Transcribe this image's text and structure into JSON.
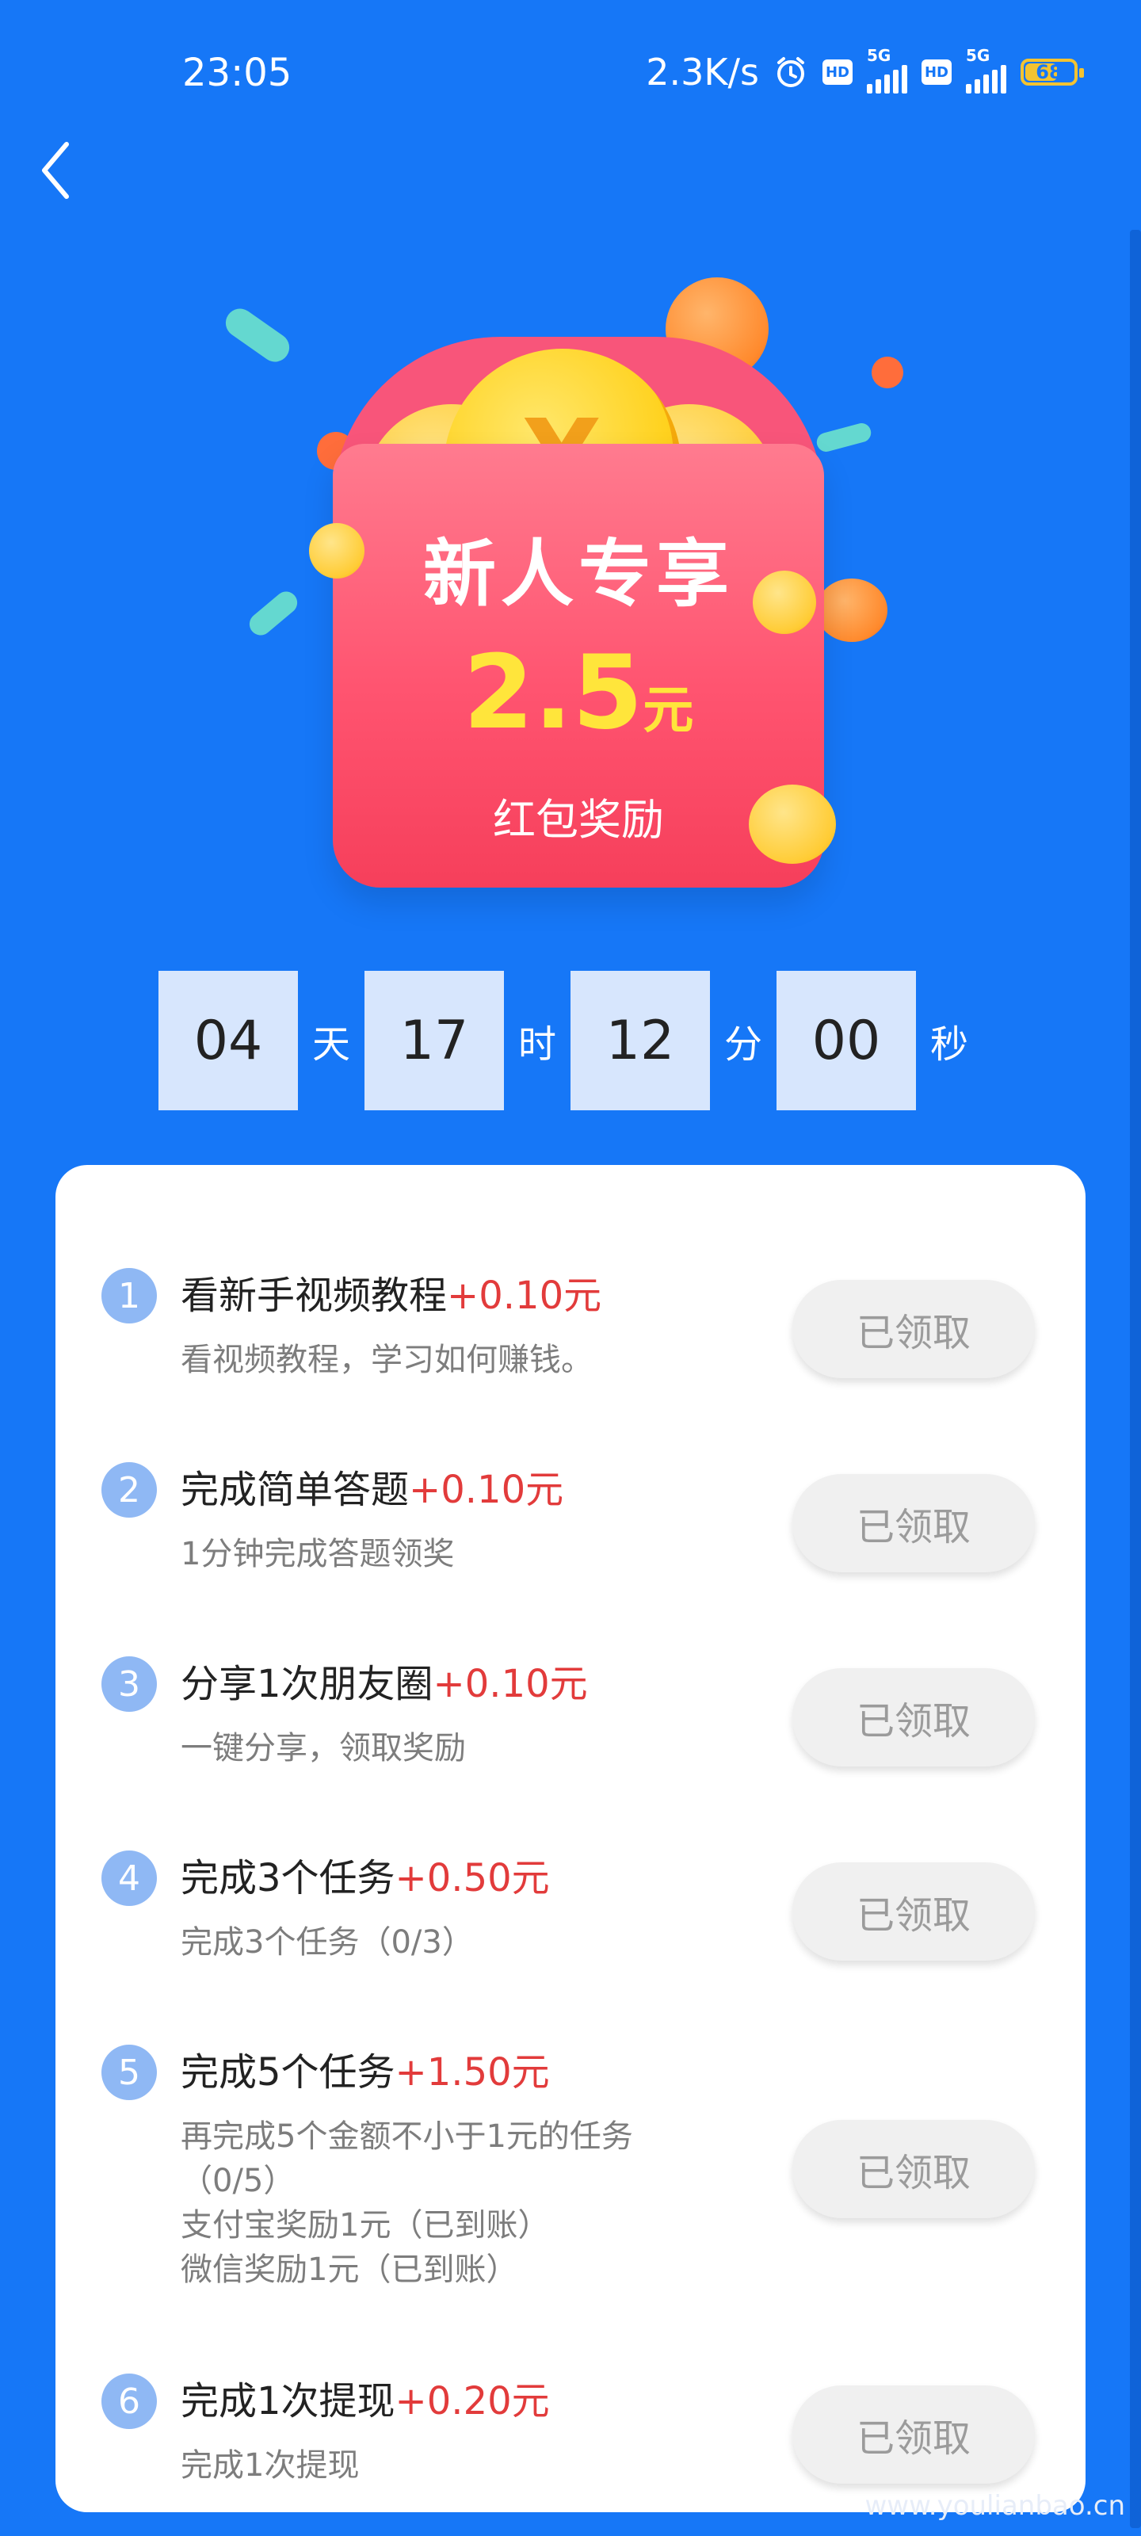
{
  "status": {
    "time": "23:05",
    "network_speed": "2.3K/s",
    "sim1_label": "5G",
    "sim2_label": "5G",
    "hd_label": "HD",
    "battery": "68",
    "battery_level": 0.68,
    "battery_color": "#f3c331"
  },
  "hero": {
    "title": "新人专享",
    "amount": "2.5",
    "unit": "元",
    "subtitle": "红包奖励"
  },
  "countdown": {
    "days": "04",
    "days_label": "天",
    "hours": "17",
    "hours_label": "时",
    "minutes": "12",
    "minutes_label": "分",
    "seconds": "00",
    "seconds_label": "秒"
  },
  "tasks": [
    {
      "num": "1",
      "title": "看新手视频教程",
      "reward": "+0.10元",
      "desc": "看视频教程，学习如何赚钱。",
      "button": "已领取"
    },
    {
      "num": "2",
      "title": "完成简单答题",
      "reward": "+0.10元",
      "desc": "1分钟完成答题领奖",
      "button": "已领取"
    },
    {
      "num": "3",
      "title": "分享1次朋友圈",
      "reward": "+0.10元",
      "desc": "一键分享，领取奖励",
      "button": "已领取"
    },
    {
      "num": "4",
      "title": "完成3个任务",
      "reward": "+0.50元",
      "desc": "完成3个任务（0/3）",
      "button": "已领取"
    },
    {
      "num": "5",
      "title": "完成5个任务",
      "reward": "+1.50元",
      "desc_lines": [
        "再完成5个金额不小于1元的任务",
        "（0/5）",
        "支付宝奖励1元（已到账）",
        "微信奖励1元（已到账）"
      ],
      "button": "已领取"
    },
    {
      "num": "6",
      "title": "完成1次提现",
      "reward": "+0.20元",
      "desc": "完成1次提现",
      "button": "已领取"
    }
  ],
  "watermark": "www.youlianbao.cn",
  "colors": {
    "background": "#1677f7",
    "reward": "#e23b3b",
    "envelope": "#ff5470",
    "amount": "#ffe53b"
  }
}
